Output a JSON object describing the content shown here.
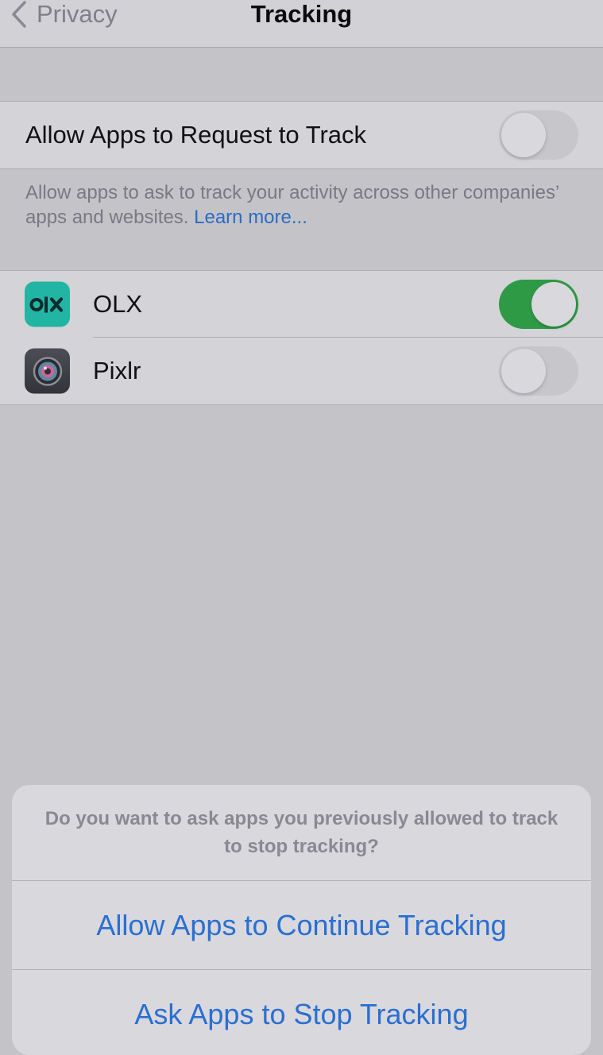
{
  "nav": {
    "back_label": "Privacy",
    "title": "Tracking"
  },
  "allow_request": {
    "label": "Allow Apps to Request to Track",
    "enabled": false
  },
  "footer": {
    "text": "Allow apps to ask to track your activity across other companies’ apps and websites.",
    "link": "Learn more..."
  },
  "apps": [
    {
      "name": "OLX",
      "icon": "olx-app-icon",
      "enabled": true,
      "icon_color": "#22b5a4"
    },
    {
      "name": "Pixlr",
      "icon": "pixlr-app-icon",
      "enabled": false,
      "icon_color": "#404147"
    }
  ],
  "action_sheet": {
    "message": "Do you want to ask apps you previously allowed to track to stop tracking?",
    "continue_label": "Allow Apps to Continue Tracking",
    "stop_label": "Ask Apps to Stop Tracking"
  },
  "colors": {
    "accent": "#2a6fd1",
    "toggle_on": "#2f9a45"
  }
}
